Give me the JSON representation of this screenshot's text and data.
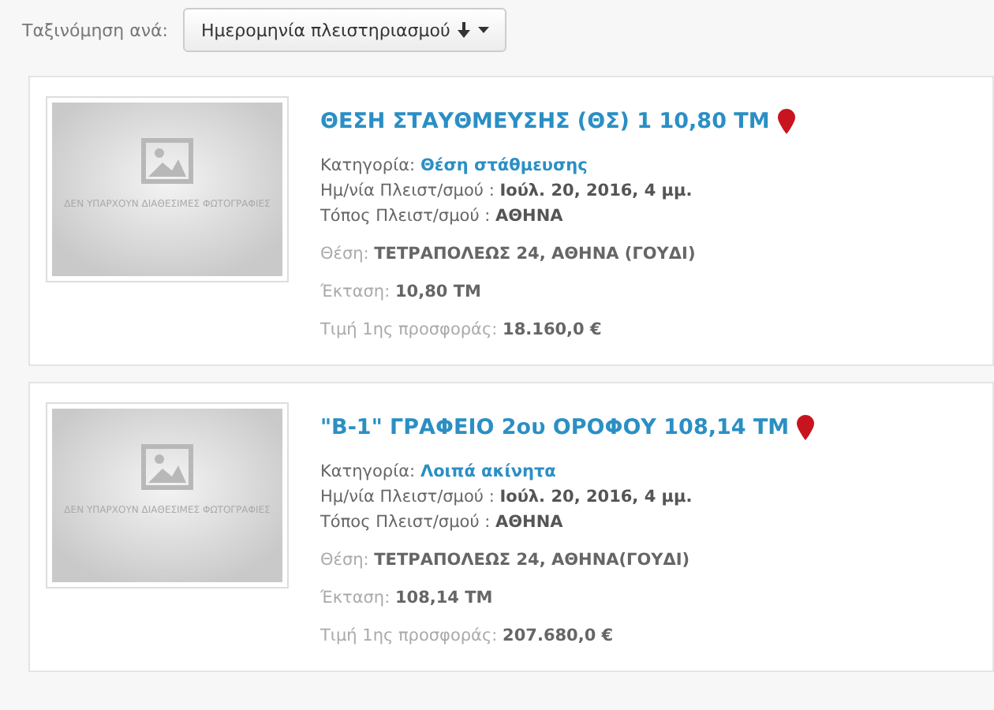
{
  "sort": {
    "label": "Ταξινόμηση ανά:",
    "button": "Ημερομηνία πλειστηριασμού"
  },
  "listings": [
    {
      "photo_text": "ΔΕΝ ΥΠΑΡΧΟΥΝ ΔΙΑΘΕΣΙΜΕΣ ΦΩΤΟΓΡΑΦΙΕΣ",
      "title": "ΘΕΣΗ ΣΤΑΥΘΜΕΥΣΗΣ (ΘΣ) 1 10,80 ΤΜ",
      "category_label": "Κατηγορία:",
      "category": "Θέση στάθμευσης",
      "date_label": "Ημ/νία Πλειστ/σμού :",
      "date": "Ιούλ. 20, 2016, 4 μμ.",
      "place_label": "Τόπος Πλειστ/σμού :",
      "place": "ΑΘΗΝΑ",
      "location_label": "Θέση:",
      "location": "ΤΕΤΡΑΠΟΛΕΩΣ 24, ΑΘΗΝΑ (ΓΟΥΔΙ)",
      "area_label": "Έκταση:",
      "area": "10,80 ΤΜ",
      "price_label": "Τιμή 1ης προσφοράς:",
      "price": "18.160,0 €"
    },
    {
      "photo_text": "ΔΕΝ ΥΠΑΡΧΟΥΝ ΔΙΑΘΕΣΙΜΕΣ ΦΩΤΟΓΡΑΦΙΕΣ",
      "title": "\"Β-1\" ΓΡΑΦΕΙΟ 2ου ΟΡΟΦΟΥ 108,14 ΤΜ",
      "category_label": "Κατηγορία:",
      "category": "Λοιπά ακίνητα",
      "date_label": "Ημ/νία Πλειστ/σμού :",
      "date": "Ιούλ. 20, 2016, 4 μμ.",
      "place_label": "Τόπος Πλειστ/σμού :",
      "place": "ΑΘΗΝΑ",
      "location_label": "Θέση:",
      "location": "ΤΕΤΡΑΠΟΛΕΩΣ 24, ΑΘΗΝΑ(ΓΟΥΔΙ)",
      "area_label": "Έκταση:",
      "area": "108,14 ΤΜ",
      "price_label": "Τιμή 1ης προσφοράς:",
      "price": "207.680,0 €"
    }
  ]
}
